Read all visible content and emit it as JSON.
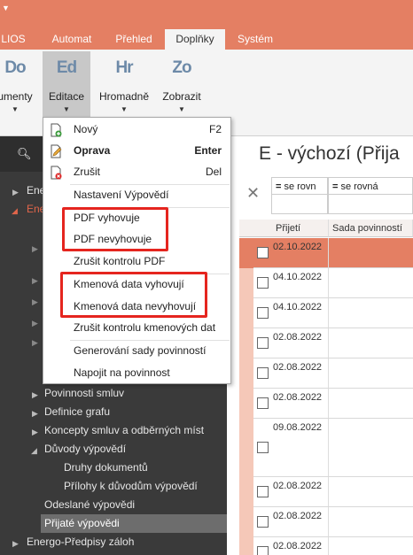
{
  "tabs": [
    "LIOS",
    "Automat",
    "Přehled",
    "Doplňky",
    "Systém"
  ],
  "active_tab": "Doplňky",
  "ribbon": [
    {
      "icon": "Do",
      "label": "umenty"
    },
    {
      "icon": "Ed",
      "label": "Editace"
    },
    {
      "icon": "Hr",
      "label": "Hromadně"
    },
    {
      "icon": "Zo",
      "label": "Zobrazit"
    }
  ],
  "menu": {
    "new": {
      "label": "Nový",
      "shortcut": "F2"
    },
    "edit": {
      "label": "Oprava",
      "shortcut": "Enter"
    },
    "cancel": {
      "label": "Zrušit",
      "shortcut": "Del"
    },
    "termination_settings": "Nastavení Výpovědí",
    "pdf_ok": "PDF vyhovuje",
    "pdf_fail": "PDF nevyhovuje",
    "pdf_cancel": "Zrušit kontrolu PDF",
    "master_ok": "Kmenová data vyhovují",
    "master_fail": "Kmenová data nevyhovují",
    "master_cancel": "Zrušit kontrolu kmenových dat",
    "generate_set": "Generování sady povinností",
    "attach_obligation": "Napojit na povinnost"
  },
  "nav": {
    "top_items": [
      "Ener",
      "Ene"
    ],
    "items": [
      "Povinnosti smluv",
      "Definice grafu",
      "Koncepty smluv a odběrných míst",
      "Důvody výpovědí",
      "Druhy dokumentů",
      "Přílohy k důvodům výpovědí",
      "Odeslané výpovědi",
      "Přijaté výpovědi",
      "Energo-Předpisy záloh"
    ]
  },
  "main": {
    "title": "E - výchozí (Přija",
    "filters": [
      {
        "op": "=",
        "text": "se rovn"
      },
      {
        "op": "=",
        "text": "se rovná"
      }
    ],
    "columns": [
      "Přijetí",
      "Sada povinností"
    ],
    "rows": [
      "02.10.2022",
      "04.10.2022",
      "04.10.2022",
      "02.08.2022",
      "02.08.2022",
      "02.08.2022",
      "09.08.2022",
      "02.08.2022",
      "02.08.2022",
      "02.08.2022"
    ]
  },
  "colors": {
    "accent": "#e47f63",
    "highlight_box": "#e5251f",
    "nav_bg": "#3a3a3a"
  }
}
